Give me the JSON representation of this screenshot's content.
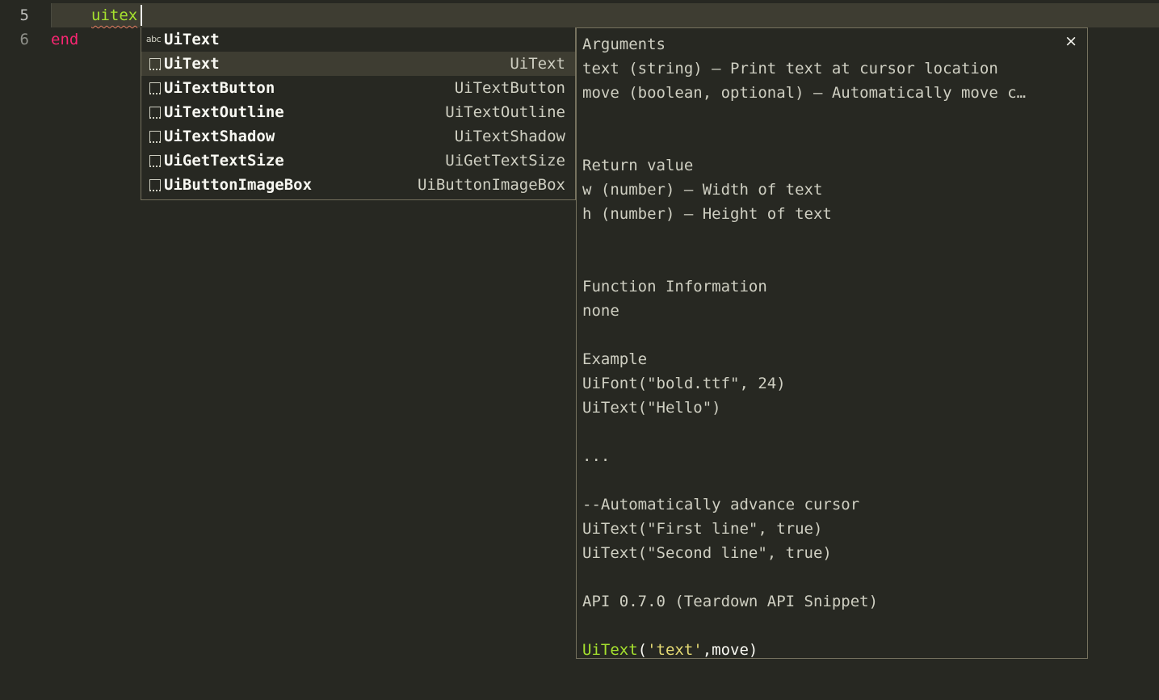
{
  "editor": {
    "lines": [
      {
        "number": "5",
        "text": "uitex"
      },
      {
        "number": "6",
        "text": "end"
      }
    ],
    "colors": {
      "background": "#272822",
      "current_line": "#3e3d32",
      "keyword": "#f92672",
      "identifier": "#a6e22e",
      "string": "#e6db74",
      "border": "#75715e"
    }
  },
  "completion": {
    "items": [
      {
        "kind": "abc-icon",
        "kind_label": "abc",
        "trigger": "UiText",
        "annotation": ""
      },
      {
        "kind": "snippet-icon",
        "kind_label": "",
        "trigger": "UiText",
        "annotation": "UiText",
        "selected": true
      },
      {
        "kind": "snippet-icon",
        "kind_label": "",
        "trigger": "UiTextButton",
        "annotation": "UiTextButton"
      },
      {
        "kind": "snippet-icon",
        "kind_label": "",
        "trigger": "UiTextOutline",
        "annotation": "UiTextOutline"
      },
      {
        "kind": "snippet-icon",
        "kind_label": "",
        "trigger": "UiTextShadow",
        "annotation": "UiTextShadow"
      },
      {
        "kind": "snippet-icon",
        "kind_label": "",
        "trigger": "UiGetTextSize",
        "annotation": "UiGetTextSize"
      },
      {
        "kind": "snippet-icon",
        "kind_label": "",
        "trigger": "UiButtonImageBox",
        "annotation": "UiButtonImageBox"
      }
    ]
  },
  "doc": {
    "close_label": "×",
    "lines": [
      "Arguments",
      "text (string) – Print text at cursor location",
      "move (boolean, optional) – Automatically move c…",
      "",
      "",
      "Return value",
      "w (number) – Width of text",
      "h (number) – Height of text",
      "",
      "",
      "Function Information",
      "none",
      "",
      "Example",
      "UiFont(\"bold.ttf\", 24)",
      "UiText(\"Hello\")",
      "",
      "...",
      "",
      "--Automatically advance cursor",
      "UiText(\"First line\", true)",
      "UiText(\"Second line\", true)",
      "",
      "API 0.7.0 (Teardown API Snippet)",
      ""
    ],
    "signature": {
      "fn": "UiText",
      "open": "(",
      "arg1": "'text'",
      "rest": ",move)"
    }
  }
}
